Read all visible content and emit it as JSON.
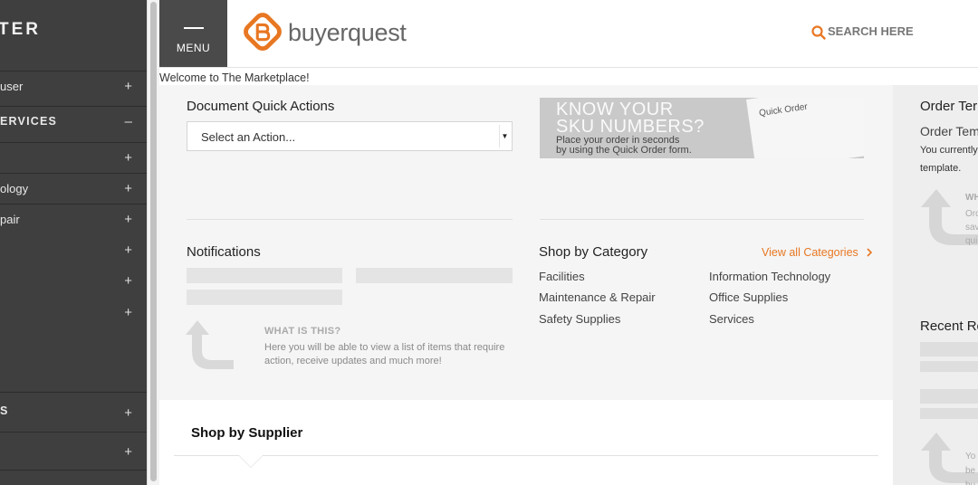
{
  "sidebar": {
    "title": "TER",
    "items": [
      {
        "label": "user",
        "toggle": "+"
      },
      {
        "label": "ERVICES",
        "toggle": "–"
      },
      {
        "label": "",
        "toggle": "+"
      },
      {
        "label": "ology",
        "toggle": "+"
      },
      {
        "label": "pair",
        "toggle": "+"
      },
      {
        "label": "",
        "toggle": "+"
      },
      {
        "label": "",
        "toggle": "+"
      },
      {
        "label": "",
        "toggle": "+"
      },
      {
        "label": "S",
        "toggle": "+"
      },
      {
        "label": "",
        "toggle": "+"
      }
    ]
  },
  "header": {
    "menu_label": "MENU",
    "logo_text": "buyerquest",
    "search_label": "SEARCH HERE",
    "accent_color": "#e87722"
  },
  "welcome": "Welcome to The Marketplace!",
  "quick_actions": {
    "title": "Document Quick Actions",
    "select_value": "Select an Action..."
  },
  "banner": {
    "line1": "KNOW YOUR",
    "line2": "SKU NUMBERS?",
    "sub1": "Place your order in seconds",
    "sub2": "by using the Quick Order form.",
    "card_label": "Quick Order"
  },
  "notifications": {
    "title": "Notifications",
    "what_title": "WHAT IS THIS?",
    "what_desc": "Here you will be able to view a list of items that require action, receive updates and much more!"
  },
  "categories": {
    "title": "Shop by Category",
    "view_all": "View all Categories",
    "items": [
      "Facilities",
      "Information Technology",
      "Maintenance & Repair",
      "Office Supplies",
      "Safety Supplies",
      "Services"
    ]
  },
  "supplier": {
    "title": "Shop by Supplier"
  },
  "right": {
    "order_title": "Order Ter",
    "order_sub": "Order Tem",
    "order_text1": "You currently",
    "order_text2": "template.",
    "what1": "WH",
    "what2": "Ord",
    "what3": "sav",
    "what4": "qui",
    "recent_title": "Recent Re",
    "what5": "Yo",
    "what6": "be",
    "what7": "bu"
  }
}
